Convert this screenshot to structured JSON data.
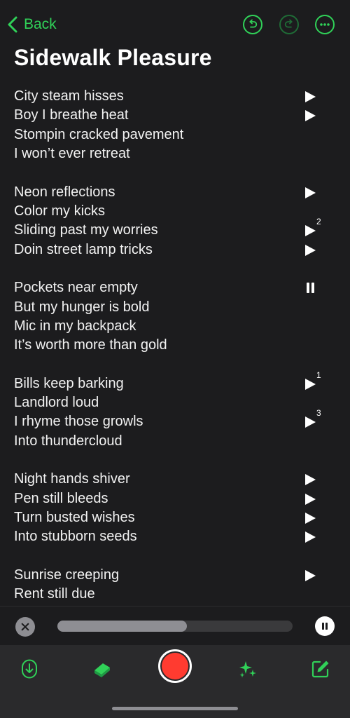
{
  "nav": {
    "back_label": "Back"
  },
  "title": "Sidewalk Pleasure",
  "stanzas": [
    {
      "lines": [
        {
          "text": "City steam hisses",
          "control": "play",
          "badge": ""
        },
        {
          "text": "Boy I breathe heat",
          "control": "play",
          "badge": ""
        },
        {
          "text": "Stompin cracked pavement",
          "control": "",
          "badge": ""
        },
        {
          "text": "I won’t ever retreat",
          "control": "",
          "badge": ""
        }
      ]
    },
    {
      "lines": [
        {
          "text": "Neon reflections",
          "control": "play",
          "badge": ""
        },
        {
          "text": "Color my kicks",
          "control": "",
          "badge": ""
        },
        {
          "text": "Sliding past my worries",
          "control": "play",
          "badge": "2"
        },
        {
          "text": "Doin street lamp tricks",
          "control": "play",
          "badge": ""
        }
      ]
    },
    {
      "lines": [
        {
          "text": "Pockets near empty",
          "control": "pause",
          "badge": ""
        },
        {
          "text": "But my hunger is bold",
          "control": "",
          "badge": ""
        },
        {
          "text": "Mic in my backpack",
          "control": "",
          "badge": ""
        },
        {
          "text": "It’s worth more than gold",
          "control": "",
          "badge": ""
        }
      ]
    },
    {
      "lines": [
        {
          "text": "Bills keep barking",
          "control": "play",
          "badge": "1"
        },
        {
          "text": "Landlord loud",
          "control": "",
          "badge": ""
        },
        {
          "text": "I rhyme those growls",
          "control": "play",
          "badge": "3"
        },
        {
          "text": "Into thundercloud",
          "control": "",
          "badge": ""
        }
      ]
    },
    {
      "lines": [
        {
          "text": "Night hands shiver",
          "control": "play",
          "badge": ""
        },
        {
          "text": "Pen still bleeds",
          "control": "play",
          "badge": ""
        },
        {
          "text": "Turn busted wishes",
          "control": "play",
          "badge": ""
        },
        {
          "text": "Into stubborn seeds",
          "control": "play",
          "badge": ""
        }
      ]
    },
    {
      "lines": [
        {
          "text": "Sunrise creeping",
          "control": "play",
          "badge": ""
        },
        {
          "text": "Rent still due",
          "control": "",
          "badge": ""
        }
      ]
    }
  ],
  "player": {
    "progress": 0.55
  },
  "colors": {
    "accent": "#30d158",
    "record": "#ff3b30",
    "background": "#1c1c1e",
    "toolbar": "#2a2a2c"
  },
  "icons": {
    "nav": [
      "chevron-left-icon",
      "undo-icon",
      "redo-icon",
      "more-icon"
    ],
    "toolbar": [
      "download-icon",
      "books-icon",
      "record-icon",
      "sparkles-icon",
      "compose-icon"
    ]
  }
}
